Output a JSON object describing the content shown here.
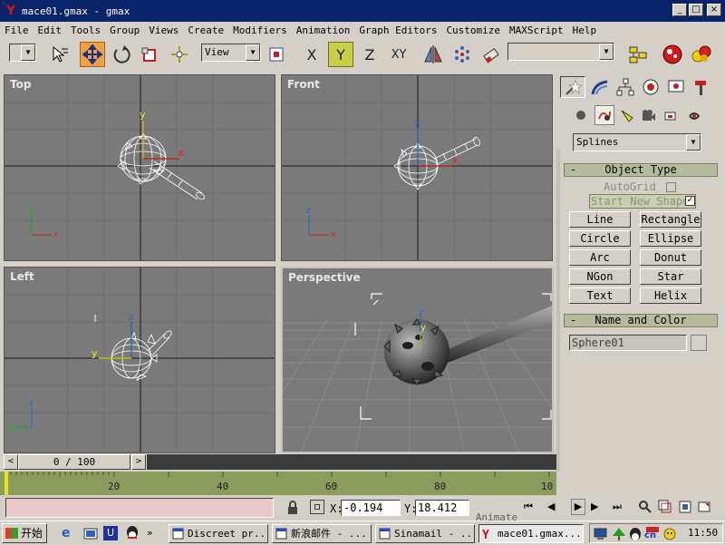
{
  "window": {
    "title": "mace01.gmax - gmax",
    "min": "_",
    "max": "□",
    "close": "×"
  },
  "menu": [
    "File",
    "Edit",
    "Tools",
    "Group",
    "Views",
    "Create",
    "Modifiers",
    "Animation",
    "Graph Editors",
    "Customize",
    "MAXScript",
    "Help"
  ],
  "toolbar": {
    "view_dropdown": "View",
    "axis_x": "X",
    "axis_y": "Y",
    "axis_z": "Z",
    "axis_xy": "XY"
  },
  "viewports": {
    "top": "Top",
    "front": "Front",
    "left": "Left",
    "perspective": "Perspective"
  },
  "command_panel": {
    "category": "Splines",
    "object_type_title": "Object Type",
    "autogrid": "AutoGrid",
    "start_new_shape": "Start New Shape",
    "buttons": [
      "Line",
      "Rectangle",
      "Circle",
      "Ellipse",
      "Arc",
      "Donut",
      "NGon",
      "Star",
      "Text",
      "Helix"
    ],
    "name_color_title": "Name and Color",
    "name_value": "Sphere01"
  },
  "timeline": {
    "frame_label": "0 / 100",
    "ticks": [
      "20",
      "40",
      "60",
      "80",
      "10"
    ]
  },
  "status": {
    "x_label": "X:",
    "x_value": "-0.194",
    "y_label": "Y:",
    "y_value": "18.412",
    "animate": "Animate"
  },
  "taskbar": {
    "start": "开始",
    "tasks": [
      "Discreet pr...",
      "新浪邮件 - ...",
      "Sinamail - ...",
      "mace01.gmax..."
    ],
    "time": "11:50",
    "tray_cn": "cn"
  }
}
